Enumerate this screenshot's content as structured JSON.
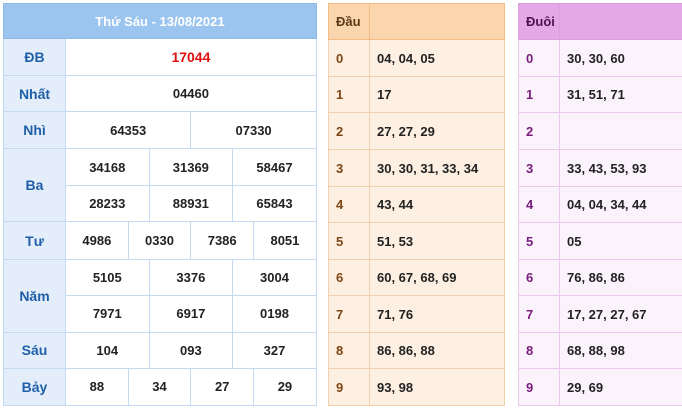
{
  "results": {
    "title": "Thứ Sáu - 13/08/2021",
    "prizes": {
      "db": {
        "label": "ĐB",
        "values": [
          "17044"
        ]
      },
      "nhat": {
        "label": "Nhất",
        "values": [
          "04460"
        ]
      },
      "nhi": {
        "label": "Nhì",
        "values": [
          "64353",
          "07330"
        ]
      },
      "ba": {
        "label": "Ba",
        "values": [
          "34168",
          "31369",
          "58467",
          "28233",
          "88931",
          "65843"
        ]
      },
      "tu": {
        "label": "Tư",
        "values": [
          "4986",
          "0330",
          "7386",
          "8051"
        ]
      },
      "nam": {
        "label": "Năm",
        "values": [
          "5105",
          "3376",
          "3004",
          "7971",
          "6917",
          "0198"
        ]
      },
      "sau": {
        "label": "Sáu",
        "values": [
          "104",
          "093",
          "327"
        ]
      },
      "bay": {
        "label": "Bảy",
        "values": [
          "88",
          "34",
          "27",
          "29"
        ]
      }
    },
    "colors": {
      "special_prize": "#e01010",
      "header_bg": "#9bc4ee"
    }
  },
  "dau": {
    "header": "Đầu",
    "rows": [
      {
        "digit": "0",
        "values": "04, 04, 05"
      },
      {
        "digit": "1",
        "values": "17"
      },
      {
        "digit": "2",
        "values": "27, 27, 29"
      },
      {
        "digit": "3",
        "values": "30, 30, 31, 33, 34"
      },
      {
        "digit": "4",
        "values": "43, 44"
      },
      {
        "digit": "5",
        "values": "51, 53"
      },
      {
        "digit": "6",
        "values": "60, 67, 68, 69"
      },
      {
        "digit": "7",
        "values": "71, 76"
      },
      {
        "digit": "8",
        "values": "86, 86, 88"
      },
      {
        "digit": "9",
        "values": "93, 98"
      }
    ]
  },
  "duoi": {
    "header": "Đuôi",
    "rows": [
      {
        "digit": "0",
        "values": "30, 30, 60"
      },
      {
        "digit": "1",
        "values": "31, 51, 71"
      },
      {
        "digit": "2",
        "values": ""
      },
      {
        "digit": "3",
        "values": "33, 43, 53, 93"
      },
      {
        "digit": "4",
        "values": "04, 04, 34, 44"
      },
      {
        "digit": "5",
        "values": "05"
      },
      {
        "digit": "6",
        "values": "76, 86, 86"
      },
      {
        "digit": "7",
        "values": "17, 27, 27, 67"
      },
      {
        "digit": "8",
        "values": "68, 88, 98"
      },
      {
        "digit": "9",
        "values": "29, 69"
      }
    ]
  }
}
